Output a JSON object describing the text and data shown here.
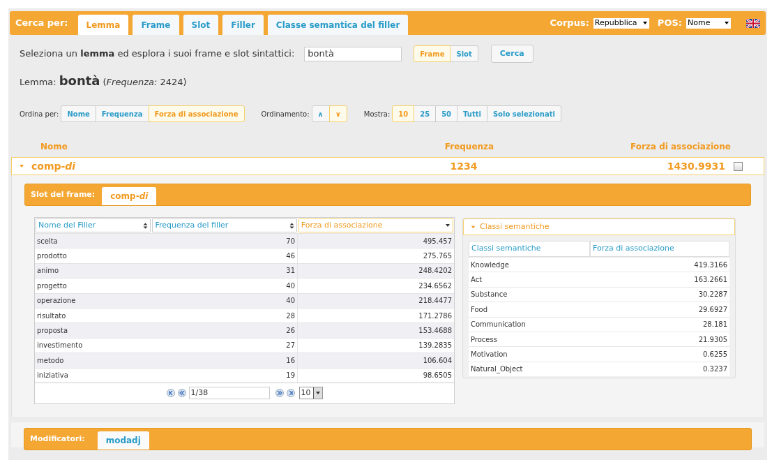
{
  "search_bar": {
    "label": "Cerca per:",
    "tabs": [
      {
        "label": "Lemma",
        "selected": true
      },
      {
        "label": "Frame",
        "selected": false
      },
      {
        "label": "Slot",
        "selected": false
      },
      {
        "label": "Filler",
        "selected": false
      },
      {
        "label": "Classe semantica del filler",
        "selected": false
      }
    ],
    "corpus": {
      "label": "Corpus:",
      "value": "Repubblica"
    },
    "pos": {
      "label": "POS:",
      "value": "Nome"
    }
  },
  "query": {
    "prompt": "Seleziona un **lemma** ed esplora i suoi frame e slot sintattici:",
    "value": "bontà",
    "modes": [
      {
        "label": "Frame",
        "selected": true
      },
      {
        "label": "Slot",
        "selected": false
      }
    ],
    "submit": "Cerca"
  },
  "lemma": {
    "label": "Lemma:",
    "word": "bontà",
    "frequency": "(*Frequenza:* 2424)"
  },
  "controls": [
    {
      "label": "Ordina per:",
      "buttons": [
        {
          "label": "Nome",
          "selected": false
        },
        {
          "label": "Frequenza",
          "selected": false
        },
        {
          "label": "Forza di associazione",
          "selected": true
        }
      ]
    },
    {
      "label": "Ordinamento:",
      "buttons": [
        {
          "label": "∧",
          "selected": false
        },
        {
          "label": "∨",
          "selected": true
        }
      ]
    },
    {
      "label": "Mostra:",
      "buttons": [
        {
          "label": "10",
          "selected": true
        },
        {
          "label": "25",
          "selected": false
        },
        {
          "label": "50",
          "selected": false
        },
        {
          "label": "Tutti",
          "selected": false
        },
        {
          "label": "Solo selezionati",
          "selected": false
        }
      ]
    }
  ],
  "frames_table": {
    "columns": [
      "Nome",
      "Frequenza",
      "Forza di associazione"
    ],
    "rows": [
      {
        "name": "comp-*di*",
        "frequency": "1234",
        "strength": "1430.9931",
        "expanded": true,
        "checked": false
      }
    ]
  },
  "slot_bar": {
    "label": "Slot del frame:",
    "tabs": [
      {
        "label": "comp-*di*",
        "selected": true
      }
    ]
  },
  "filler_table": {
    "columns": [
      {
        "label": "Nome del Filler",
        "sorted": false
      },
      {
        "label": "Frequenza del filler",
        "sorted": false
      },
      {
        "label": "Forza di associazione",
        "sorted": true
      }
    ],
    "rows": [
      [
        "scelta",
        "70",
        "495.457"
      ],
      [
        "prodotto",
        "46",
        "275.765"
      ],
      [
        "animo",
        "31",
        "248.4202"
      ],
      [
        "progetto",
        "40",
        "234.6562"
      ],
      [
        "operazione",
        "40",
        "218.4477"
      ],
      [
        "risultato",
        "28",
        "171.2786"
      ],
      [
        "proposta",
        "26",
        "153.4688"
      ],
      [
        "investimento",
        "27",
        "139.2835"
      ],
      [
        "metodo",
        "16",
        "106.604"
      ],
      [
        "iniziativa",
        "19",
        "98.6505"
      ]
    ],
    "pager": {
      "page": "1/38",
      "page_size": "10"
    }
  },
  "semantic_panel": {
    "title": "Classi semantiche",
    "expanded": true,
    "columns": [
      "Classi semantiche",
      "Forza di associazione"
    ],
    "rows": [
      [
        "Knowledge",
        "419.3166"
      ],
      [
        "Act",
        "163.2661"
      ],
      [
        "Substance",
        "30.2287"
      ],
      [
        "Food",
        "29.6927"
      ],
      [
        "Communication",
        "28.181"
      ],
      [
        "Process",
        "21.9305"
      ],
      [
        "Motivation",
        "0.6255"
      ],
      [
        "Natural_Object",
        "0.3237"
      ]
    ]
  },
  "modifiers_bar": {
    "label": "Modificatori:",
    "tabs": [
      {
        "label": "modadj",
        "selected": false
      }
    ]
  }
}
